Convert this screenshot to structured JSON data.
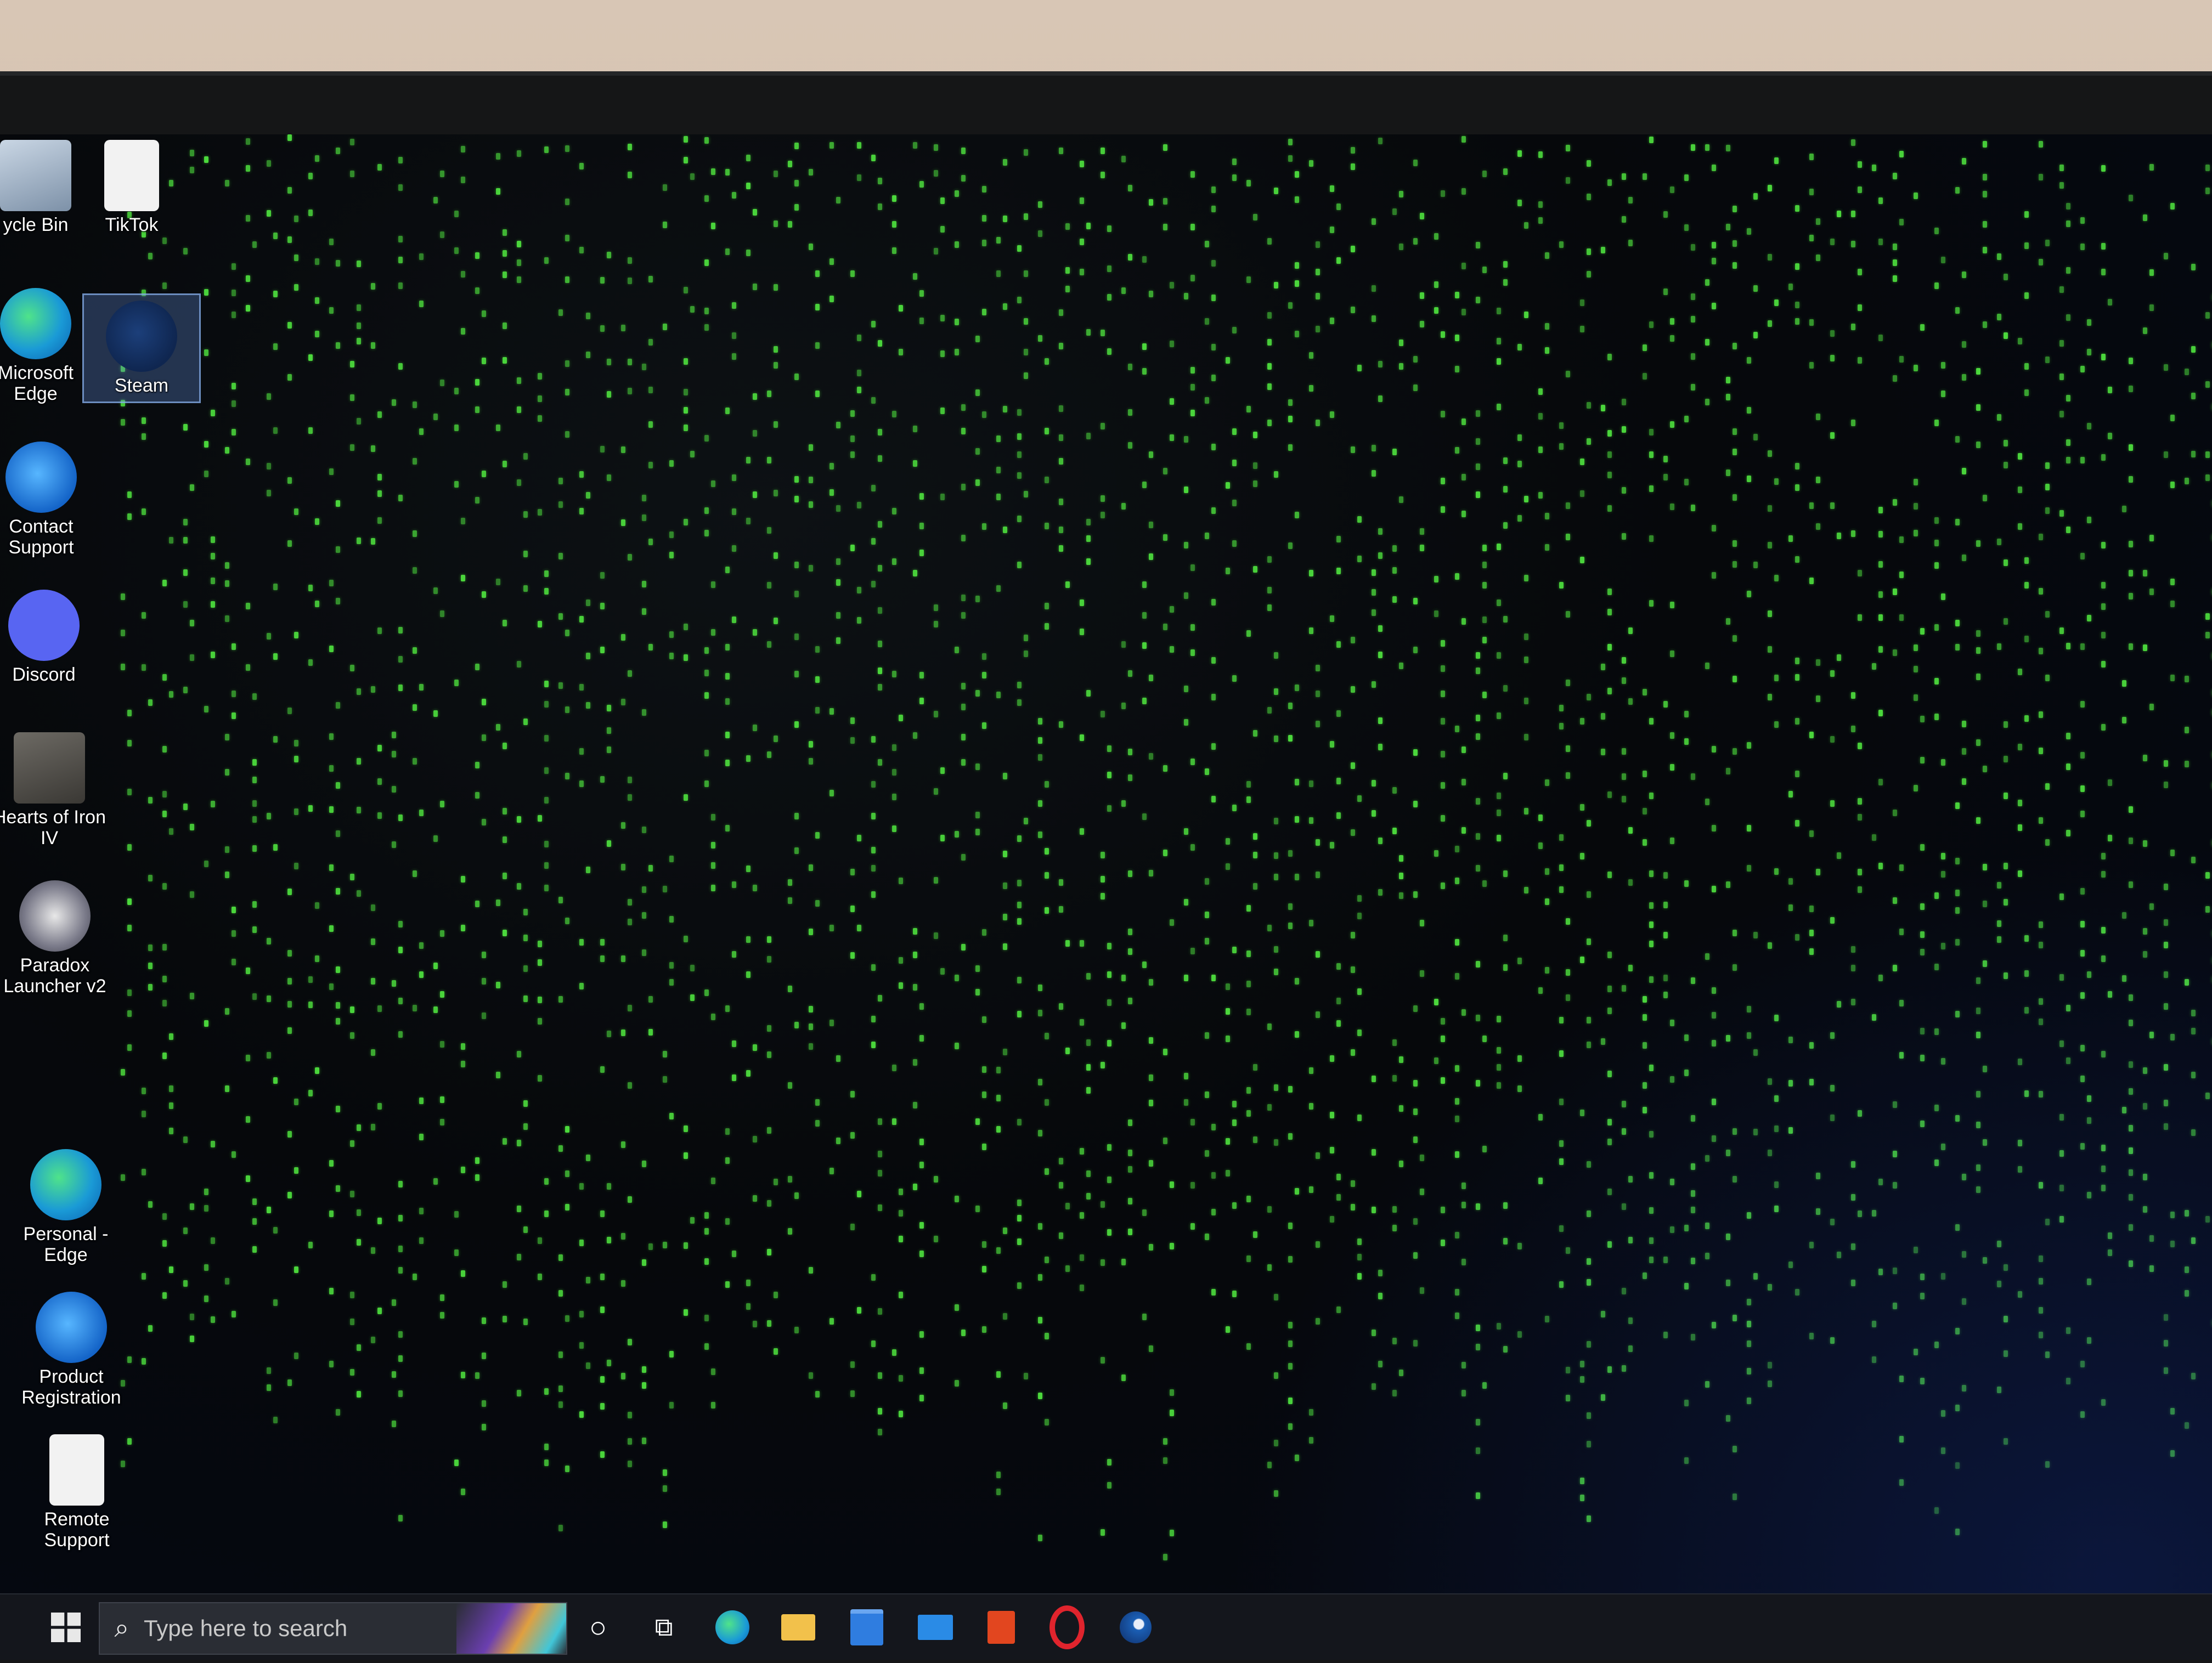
{
  "desktop": {
    "icons": [
      {
        "label": "ycle Bin",
        "icon": "recycle-bin-icon"
      },
      {
        "label": "TikTok",
        "icon": "file-icon"
      },
      {
        "label": "Microsoft Edge",
        "icon": "edge-icon"
      },
      {
        "label": "Steam",
        "icon": "steam-icon",
        "selected": true
      },
      {
        "label": "Contact Support",
        "icon": "ie-icon"
      },
      {
        "label": "Discord",
        "icon": "discord-icon"
      },
      {
        "label": "Hearts of Iron IV",
        "icon": "hoi-icon"
      },
      {
        "label": "Paradox Launcher v2",
        "icon": "paradox-icon"
      },
      {
        "label": "Personal - Edge",
        "icon": "edge-icon"
      },
      {
        "label": "Product Registration",
        "icon": "ie-icon"
      },
      {
        "label": "Remote Support",
        "icon": "file-icon"
      }
    ],
    "wallpaper": {
      "style": "matrix digital rain",
      "rain_color": "#4bd83c"
    }
  },
  "taskbar": {
    "start_icon": "windows-logo-icon",
    "search_placeholder": "Type here to search",
    "search_icon": "search-icon",
    "pinned": [
      {
        "name": "cortana",
        "icon": "circle-icon",
        "glyph": "○"
      },
      {
        "name": "task-view",
        "icon": "task-view-icon",
        "glyph": "⧉"
      },
      {
        "name": "edge",
        "icon": "edge-icon",
        "color": "#1a9ad6"
      },
      {
        "name": "file-explorer",
        "icon": "folder-icon",
        "color": "#f2c14b"
      },
      {
        "name": "store",
        "icon": "store-icon",
        "color": "#2f7de0"
      },
      {
        "name": "mail",
        "icon": "mail-icon",
        "color": "#2a8be6"
      },
      {
        "name": "office",
        "icon": "office-icon",
        "color": "#e2461f"
      },
      {
        "name": "opera",
        "icon": "opera-icon",
        "color": "#e0242d"
      },
      {
        "name": "steam",
        "icon": "steam-icon",
        "color": "#1b5fb5"
      }
    ]
  }
}
